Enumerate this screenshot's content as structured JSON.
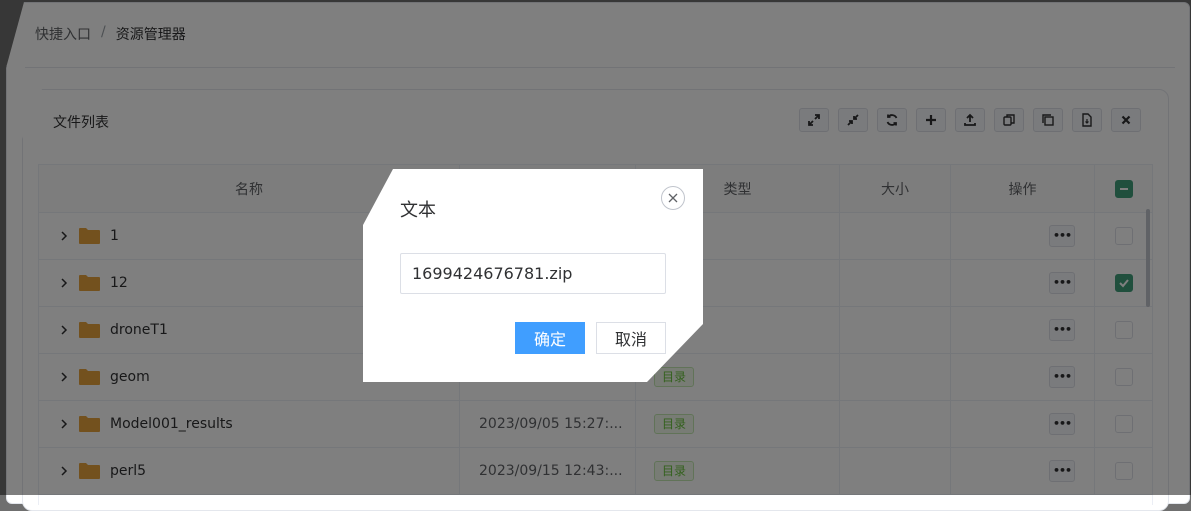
{
  "breadcrumb": {
    "items": [
      "快捷入口",
      "资源管理器"
    ],
    "separator": "/"
  },
  "card": {
    "title": "文件列表",
    "toolbar_icons": [
      "expand-icon",
      "compress-icon",
      "refresh-icon",
      "plus-icon",
      "upload-icon",
      "copy-icon",
      "duplicate-icon",
      "file-icon",
      "close-icon"
    ]
  },
  "table": {
    "columns": [
      "名称",
      "",
      "类型",
      "大小",
      "操作"
    ],
    "rows": [
      {
        "name": "1",
        "time": "",
        "type": "",
        "checked": false
      },
      {
        "name": "12",
        "time": "",
        "type": "",
        "checked": true
      },
      {
        "name": "droneT1",
        "time": "",
        "type": "",
        "checked": false
      },
      {
        "name": "geom",
        "time": "",
        "type": "目录",
        "checked": false
      },
      {
        "name": "Model001_results",
        "time": "2023/09/05 15:27:...",
        "type": "目录",
        "checked": false
      },
      {
        "name": "perl5",
        "time": "2023/09/15 12:43:...",
        "type": "目录",
        "checked": false
      }
    ],
    "more_label": "•••"
  },
  "dialog": {
    "title": "文本",
    "input_value": "1699424676781.zip",
    "ok_label": "确定",
    "cancel_label": "取消"
  },
  "colors": {
    "primary": "#409eff",
    "success": "#67c23a",
    "checkbox": "#409e7a",
    "folder": "#e6a23c"
  }
}
